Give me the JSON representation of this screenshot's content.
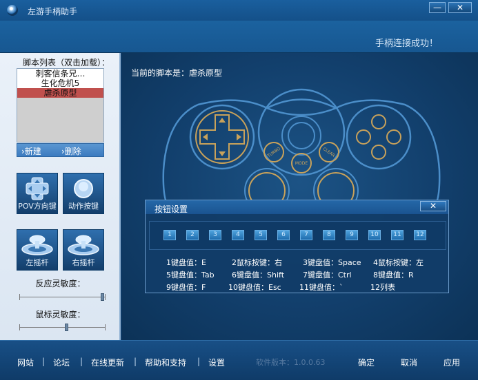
{
  "window": {
    "title": "左游手柄助手",
    "minimize_label": "—",
    "close_label": "✕"
  },
  "header": {
    "connection_status": "手柄连接成功！"
  },
  "sidebar": {
    "script_list_label": "脚本列表（双击加载）：",
    "scripts": [
      "刺客信条兄…",
      "生化危机5",
      "虐杀原型"
    ],
    "selected_script_index": 2,
    "new_label": "›新建",
    "delete_label": "›删除",
    "pov_label": "POV方向键",
    "action_label": "动作按键",
    "left_stick_label": "左摇杆",
    "right_stick_label": "右摇杆",
    "react_sensitivity_label": "反应灵敏度：",
    "react_sensitivity_value": 0.98,
    "mouse_sensitivity_label": "鼠标灵敏度：",
    "mouse_sensitivity_value": 0.55
  },
  "main": {
    "current_script": "当前的脚本是：虐杀原型",
    "gamepad_labels": {
      "turbo": "TURBO",
      "mode": "MODE",
      "clear": "CLEAR"
    }
  },
  "dialog": {
    "title": "按钮设置",
    "close_label": "✕",
    "keys": [
      "1",
      "2",
      "3",
      "4",
      "5",
      "6",
      "7",
      "8",
      "9",
      "10",
      "11",
      "12"
    ],
    "mappings": [
      [
        "1键盘值：E",
        "2鼠标按键：右",
        "3键盘值：Space",
        "4鼠标按键：左"
      ],
      [
        "5键盘值：Tab",
        "6键盘值：Shift",
        "7键盘值：Ctrl",
        "8键盘值：R"
      ],
      [
        "9键盘值：F",
        "10键盘值：Esc",
        "11键盘值：`",
        "12列表"
      ]
    ]
  },
  "footer": {
    "links": [
      "网站",
      "论坛",
      "在线更新",
      "帮助和支持",
      "设置"
    ],
    "separator": "|",
    "version": "软件版本：1.0.0.63",
    "ok_label": "确定",
    "cancel_label": "取消",
    "apply_label": "应用"
  },
  "colors": {
    "accent": "#1b629f",
    "selected_row": "#c0504d",
    "gamepad_line": "#4b8ec9",
    "gamepad_gold": "#c9a25a"
  }
}
